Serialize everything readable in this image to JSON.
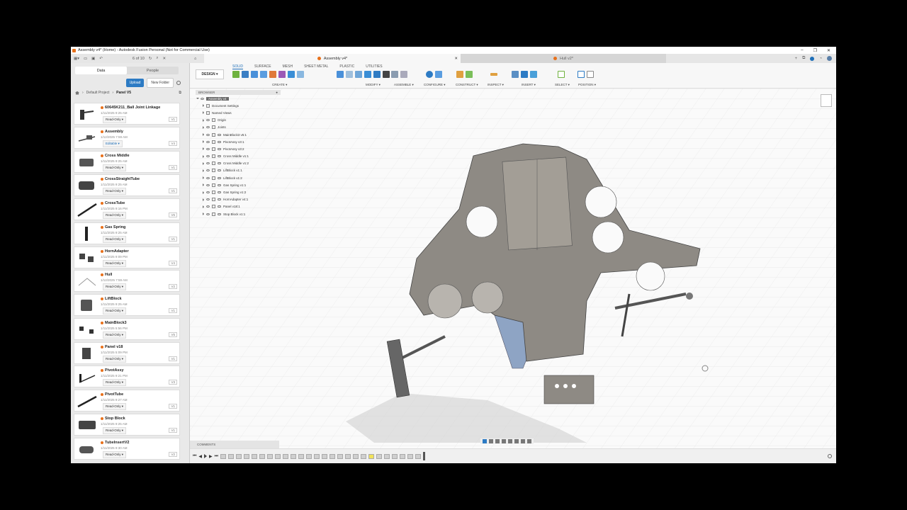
{
  "window": {
    "title": "Assembly v4* (Home) - Autodesk Fusion Personal (Not for Commercial Use)",
    "controls": [
      "–",
      "❐",
      "✕"
    ]
  },
  "data_panel": {
    "counter": "6 of 10",
    "switch": [
      "Data",
      "People"
    ],
    "upload_label": "Upload",
    "new_folder_label": "New Folder",
    "breadcrumb": [
      "Default Project",
      "Panel V5"
    ],
    "items": [
      {
        "name": "60645K211_Ball Joint Linkage",
        "date": "1/11/2025 9:25 AM",
        "perm": "Read-Only",
        "ver": "V1"
      },
      {
        "name": "Assembly",
        "date": "1/12/2025 7:59 AM",
        "perm": "Editable",
        "ver": "V4"
      },
      {
        "name": "Cross Middle",
        "date": "1/11/2025 9:25 AM",
        "perm": "Read-Only",
        "ver": "V1"
      },
      {
        "name": "CrossStraightTube",
        "date": "1/11/2025 9:25 AM",
        "perm": "Read-Only",
        "ver": "V1"
      },
      {
        "name": "CrossTube",
        "date": "1/11/2025 9:16 PM",
        "perm": "Read-Only",
        "ver": "V6"
      },
      {
        "name": "Gas Spring",
        "date": "1/11/2025 9:25 AM",
        "perm": "Read-Only",
        "ver": "V1"
      },
      {
        "name": "HornAdapter",
        "date": "1/11/2025 9:09 PM",
        "perm": "Read-Only",
        "ver": "V4"
      },
      {
        "name": "Hull",
        "date": "1/12/2025 7:59 AM",
        "perm": "Read-Only",
        "ver": "V2"
      },
      {
        "name": "LiftBlock",
        "date": "1/11/2025 9:25 AM",
        "perm": "Read-Only",
        "ver": "V1"
      },
      {
        "name": "MainBlock3",
        "date": "1/11/2025 5:56 PM",
        "perm": "Read-Only",
        "ver": "V5"
      },
      {
        "name": "Panel v18",
        "date": "1/11/2025 5:09 PM",
        "perm": "Read-Only",
        "ver": "V1"
      },
      {
        "name": "PivotAssy",
        "date": "1/11/2025 9:21 PM",
        "perm": "Read-Only",
        "ver": "V3"
      },
      {
        "name": "PivotTube",
        "date": "1/11/2025 9:27 AM",
        "perm": "Read-Only",
        "ver": "V1"
      },
      {
        "name": "Stop Block",
        "date": "1/11/2025 9:25 AM",
        "perm": "Read-Only",
        "ver": "V1"
      },
      {
        "name": "TubeInsertV2",
        "date": "1/11/2025 9:30 AM",
        "perm": "Read-Only",
        "ver": "V2"
      }
    ]
  },
  "tabs": {
    "active": "Assembly v4*",
    "inactive": "Hull v2*"
  },
  "toolbar": {
    "workspace": "DESIGN ▾",
    "ws_tabs": [
      "SOLID",
      "SURFACE",
      "MESH",
      "SHEET METAL",
      "PLASTIC",
      "UTILITIES"
    ],
    "groups": [
      "CREATE ▾",
      "MODIFY ▾",
      "ASSEMBLE ▾",
      "CONFIGURE ▾",
      "CONSTRUCT ▾",
      "INSPECT ▾",
      "INSERT ▾",
      "SELECT ▾",
      "POSITION ▾"
    ]
  },
  "browser": {
    "title": "BROWSER",
    "root": "Assembly v4",
    "rows": [
      "Document Settings",
      "Named Views",
      "Origin",
      "Joints",
      "MainBlock3 v5:1",
      "PivotAssy v3:1",
      "PivotAssy v3:2",
      "Cross Middle v1:1",
      "Cross Middle v1:2",
      "LiftBlock v1:1",
      "LiftBlock v1:2",
      "Gas Spring v1:1",
      "Gas Spring v1:2",
      "HornAdapter v4:1",
      "Panel v18:1",
      "Stop Block v1:1"
    ]
  },
  "comments_label": "COMMENTS",
  "colors": {
    "accent": "#2d7bc4",
    "orange": "#e8701a"
  }
}
